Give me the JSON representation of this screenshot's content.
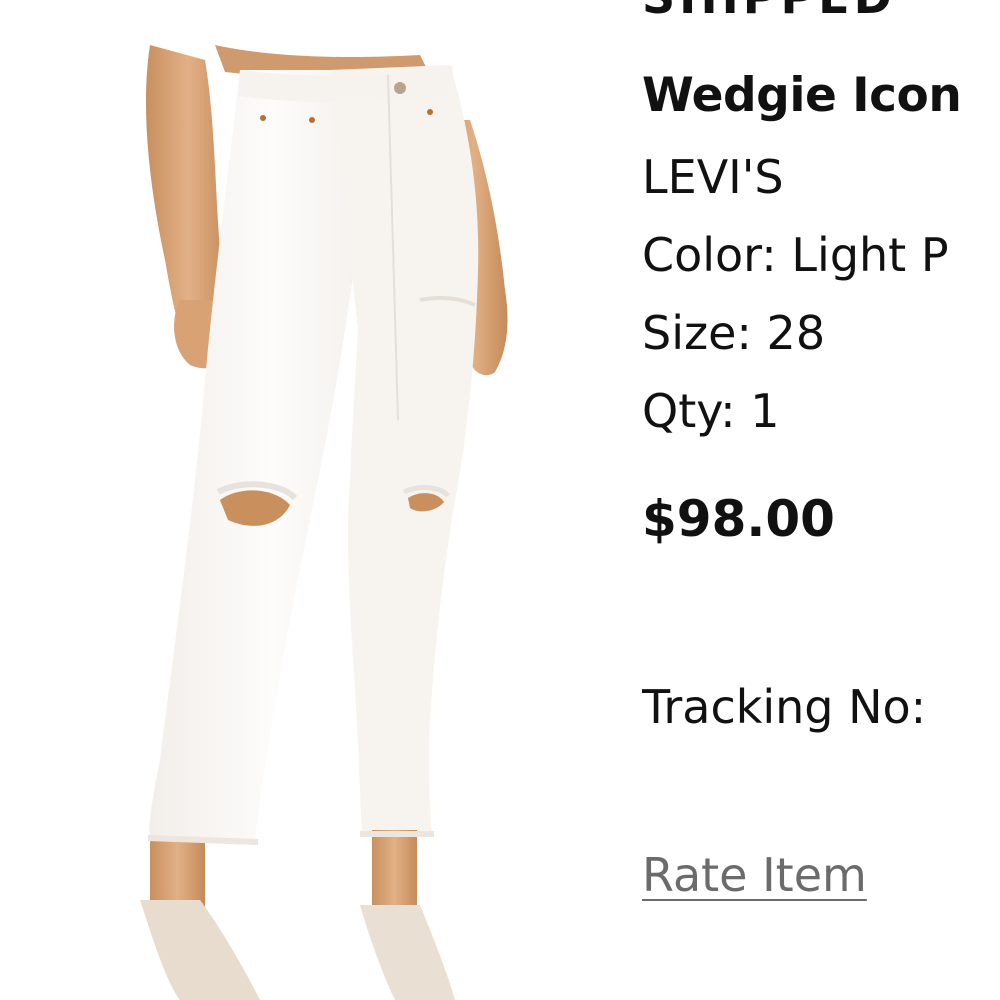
{
  "order_item": {
    "status": "SHIPPED",
    "name": "Wedgie Icon",
    "brand": "LEVI'S",
    "color_label": "Color: Light P",
    "size_label": "Size: 28",
    "qty_label": "Qty: 1",
    "price": "$98.00",
    "tracking_label": "Tracking No:",
    "rate_item_label": "Rate Item"
  },
  "image": {
    "alt": "White distressed high-rise straight leg jeans"
  },
  "colors": {
    "text": "#111111",
    "link": "#6b6b6b",
    "background": "#ffffff"
  }
}
